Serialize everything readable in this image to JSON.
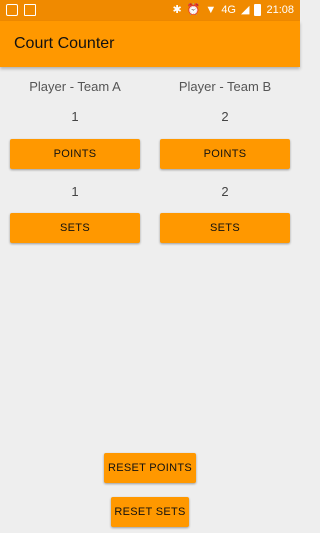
{
  "status_bar": {
    "time": "21:08",
    "network": "4G",
    "icons": [
      "notification-icon",
      "image-icon",
      "bluetooth-icon",
      "alarm-icon",
      "wifi-icon",
      "signal-icon",
      "battery-icon"
    ]
  },
  "app": {
    "title": "Court Counter"
  },
  "team_a": {
    "label": "Player - Team A",
    "points": "1",
    "points_button": "POINTS",
    "sets": "1",
    "sets_button": "SETS"
  },
  "team_b": {
    "label": "Player - Team B",
    "points": "2",
    "points_button": "POINTS",
    "sets": "2",
    "sets_button": "SETS"
  },
  "actions": {
    "reset_points": "RESET POINTS",
    "reset_sets": "RESET SETS"
  },
  "colors": {
    "accent": "#ff9800",
    "status_bar": "#f08a00",
    "background": "#eeeeee"
  }
}
